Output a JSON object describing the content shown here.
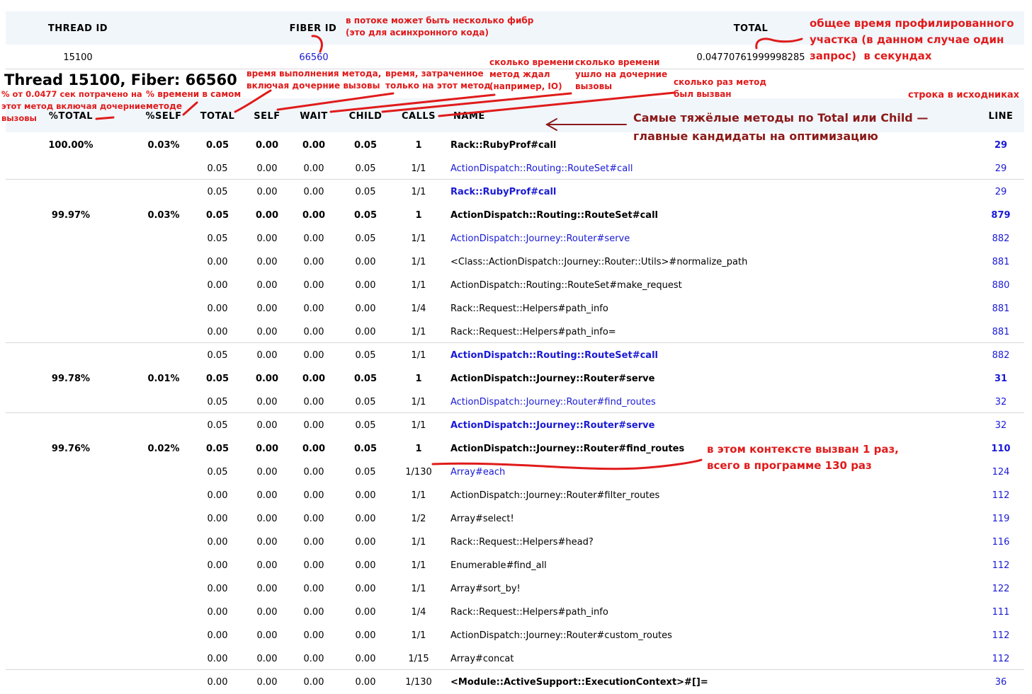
{
  "thread_header": {
    "thread_id_label": "THREAD ID",
    "fiber_id_label": "FIBER ID",
    "total_label": "TOTAL",
    "thread_id": "15100",
    "fiber_id": "66560",
    "total": "0.04770761999998285"
  },
  "thread_title": "Thread 15100, Fiber: 66560",
  "columns": {
    "ptotal": "%TOTAL",
    "pself": "%SELF",
    "total": "TOTAL",
    "self": "SELF",
    "wait": "WAIT",
    "child": "CHILD",
    "calls": "CALLS",
    "name": "NAME",
    "line": "LINE"
  },
  "annotations": {
    "fiber": "в потоке может быть несколько фибр\n(это для асинхронного кода)",
    "total_time": "общее время профилированного\nучастка (в данном случае один\nзапрос)  в секундах",
    "ptotal": "% от 0.0477 сек потрачено на\nэтот метод включая дочерние\nвызовы",
    "pself": "% времени в самом\nметоде",
    "total_col": "время выполнения метода,\nвключая дочерние вызовы",
    "self_col": "время, затраченное\nтолько на этот метод",
    "wait_col": "сколько времени\nметод ждал\n(например, IO)",
    "child_col": "сколько времени\nушло на дочерние\nвызовы",
    "calls_col": "сколько раз метод\nбыл вызван",
    "line_col": "строка в исходниках",
    "heavy": "Самые тяжёлые методы по Total или Child —\nглавные кандидаты на оптимизацию",
    "context": "в этом контексте вызван 1 раз,\nвсего в программе 130 раз"
  },
  "rows": [
    {
      "ptotal": "100.00%",
      "pself": "0.03%",
      "total": "0.05",
      "self": "0.00",
      "wait": "0.00",
      "child": "0.05",
      "calls": "1",
      "name": "Rack::RubyProf#call",
      "line": "29",
      "kind": "main"
    },
    {
      "total": "0.05",
      "self": "0.00",
      "wait": "0.00",
      "child": "0.05",
      "calls": "1/1",
      "name": "ActionDispatch::Routing::RouteSet#call",
      "line": "29",
      "kind": "child"
    },
    {
      "total": "0.05",
      "self": "0.00",
      "wait": "0.00",
      "child": "0.05",
      "calls": "1/1",
      "name": "Rack::RubyProf#call",
      "line": "29",
      "kind": "parent"
    },
    {
      "ptotal": "99.97%",
      "pself": "0.03%",
      "total": "0.05",
      "self": "0.00",
      "wait": "0.00",
      "child": "0.05",
      "calls": "1",
      "name": "ActionDispatch::Routing::RouteSet#call",
      "line": "879",
      "kind": "main"
    },
    {
      "total": "0.05",
      "self": "0.00",
      "wait": "0.00",
      "child": "0.05",
      "calls": "1/1",
      "name": "ActionDispatch::Journey::Router#serve",
      "line": "882",
      "kind": "child"
    },
    {
      "total": "0.00",
      "self": "0.00",
      "wait": "0.00",
      "child": "0.00",
      "calls": "1/1",
      "name": "<Class::ActionDispatch::Journey::Router::Utils>#normalize_path",
      "line": "881",
      "kind": "plain"
    },
    {
      "total": "0.00",
      "self": "0.00",
      "wait": "0.00",
      "child": "0.00",
      "calls": "1/1",
      "name": "ActionDispatch::Routing::RouteSet#make_request",
      "line": "880",
      "kind": "plain"
    },
    {
      "total": "0.00",
      "self": "0.00",
      "wait": "0.00",
      "child": "0.00",
      "calls": "1/4",
      "name": "Rack::Request::Helpers#path_info",
      "line": "881",
      "kind": "plain"
    },
    {
      "total": "0.00",
      "self": "0.00",
      "wait": "0.00",
      "child": "0.00",
      "calls": "1/1",
      "name": "Rack::Request::Helpers#path_info=",
      "line": "881",
      "kind": "plain"
    },
    {
      "total": "0.05",
      "self": "0.00",
      "wait": "0.00",
      "child": "0.05",
      "calls": "1/1",
      "name": "ActionDispatch::Routing::RouteSet#call",
      "line": "882",
      "kind": "parent"
    },
    {
      "ptotal": "99.78%",
      "pself": "0.01%",
      "total": "0.05",
      "self": "0.00",
      "wait": "0.00",
      "child": "0.05",
      "calls": "1",
      "name": "ActionDispatch::Journey::Router#serve",
      "line": "31",
      "kind": "main"
    },
    {
      "total": "0.05",
      "self": "0.00",
      "wait": "0.00",
      "child": "0.05",
      "calls": "1/1",
      "name": "ActionDispatch::Journey::Router#find_routes",
      "line": "32",
      "kind": "child"
    },
    {
      "total": "0.05",
      "self": "0.00",
      "wait": "0.00",
      "child": "0.05",
      "calls": "1/1",
      "name": "ActionDispatch::Journey::Router#serve",
      "line": "32",
      "kind": "parent"
    },
    {
      "ptotal": "99.76%",
      "pself": "0.02%",
      "total": "0.05",
      "self": "0.00",
      "wait": "0.00",
      "child": "0.05",
      "calls": "1",
      "name": "ActionDispatch::Journey::Router#find_routes",
      "line": "110",
      "kind": "main"
    },
    {
      "total": "0.05",
      "self": "0.00",
      "wait": "0.00",
      "child": "0.05",
      "calls": "1/130",
      "name": "Array#each",
      "line": "124",
      "kind": "child"
    },
    {
      "total": "0.00",
      "self": "0.00",
      "wait": "0.00",
      "child": "0.00",
      "calls": "1/1",
      "name": "ActionDispatch::Journey::Router#filter_routes",
      "line": "112",
      "kind": "plain"
    },
    {
      "total": "0.00",
      "self": "0.00",
      "wait": "0.00",
      "child": "0.00",
      "calls": "1/2",
      "name": "Array#select!",
      "line": "119",
      "kind": "plain"
    },
    {
      "total": "0.00",
      "self": "0.00",
      "wait": "0.00",
      "child": "0.00",
      "calls": "1/1",
      "name": "Rack::Request::Helpers#head?",
      "line": "116",
      "kind": "plain"
    },
    {
      "total": "0.00",
      "self": "0.00",
      "wait": "0.00",
      "child": "0.00",
      "calls": "1/1",
      "name": "Enumerable#find_all",
      "line": "112",
      "kind": "plain"
    },
    {
      "total": "0.00",
      "self": "0.00",
      "wait": "0.00",
      "child": "0.00",
      "calls": "1/1",
      "name": "Array#sort_by!",
      "line": "122",
      "kind": "plain"
    },
    {
      "total": "0.00",
      "self": "0.00",
      "wait": "0.00",
      "child": "0.00",
      "calls": "1/4",
      "name": "Rack::Request::Helpers#path_info",
      "line": "111",
      "kind": "plain"
    },
    {
      "total": "0.00",
      "self": "0.00",
      "wait": "0.00",
      "child": "0.00",
      "calls": "1/1",
      "name": "ActionDispatch::Journey::Router#custom_routes",
      "line": "112",
      "kind": "plain"
    },
    {
      "total": "0.00",
      "self": "0.00",
      "wait": "0.00",
      "child": "0.00",
      "calls": "1/15",
      "name": "Array#concat",
      "line": "112",
      "kind": "plain"
    },
    {
      "total": "0.00",
      "self": "0.00",
      "wait": "0.00",
      "child": "0.00",
      "calls": "1/130",
      "name": "<Module::ActiveSupport::ExecutionContext>#[]=",
      "line": "36",
      "kind": "parentbold"
    }
  ]
}
